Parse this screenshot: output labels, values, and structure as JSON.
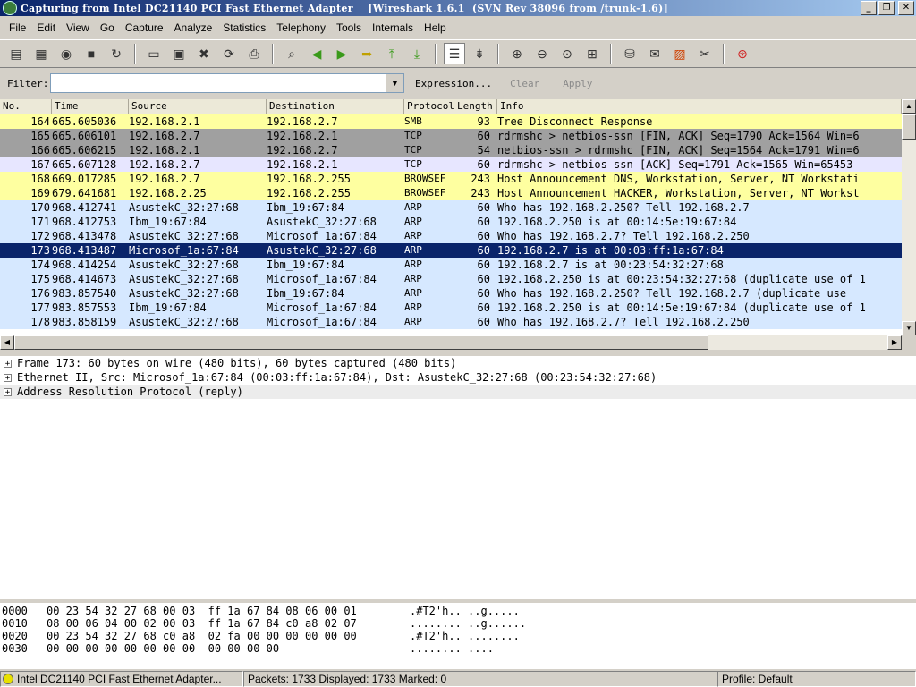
{
  "window": {
    "title": "Capturing from Intel DC21140 PCI Fast Ethernet Adapter    [Wireshark 1.6.1  (SVN Rev 38096 from /trunk-1.6)]",
    "minimize": "_",
    "maximize": "❐",
    "close": "✕"
  },
  "menu": [
    "File",
    "Edit",
    "View",
    "Go",
    "Capture",
    "Analyze",
    "Statistics",
    "Telephony",
    "Tools",
    "Internals",
    "Help"
  ],
  "filter": {
    "label": "Filter:",
    "value": "",
    "expression": "Expression...",
    "clear": "Clear",
    "apply": "Apply"
  },
  "columns": [
    "No.",
    "Time",
    "Source",
    "Destination",
    "Protocol",
    "Length",
    "Info"
  ],
  "colors": {
    "smb": "#feffa0",
    "tcp_dark": "#a0a0a0",
    "tcp_light": "#e7e6ff",
    "browser": "#feffa0",
    "arp": "#d6e8ff",
    "selected_bg": "#0a246a",
    "selected_fg": "#ffffff"
  },
  "packets": [
    {
      "no": "164",
      "time": "665.605036",
      "src": "192.168.2.1",
      "dst": "192.168.2.7",
      "proto": "SMB",
      "len": "93",
      "info": "Tree Disconnect Response",
      "color": "#feffa0"
    },
    {
      "no": "165",
      "time": "665.606101",
      "src": "192.168.2.7",
      "dst": "192.168.2.1",
      "proto": "TCP",
      "len": "60",
      "info": "rdrmshc > netbios-ssn [FIN, ACK] Seq=1790 Ack=1564 Win=6",
      "color": "#a0a0a0"
    },
    {
      "no": "166",
      "time": "665.606215",
      "src": "192.168.2.1",
      "dst": "192.168.2.7",
      "proto": "TCP",
      "len": "54",
      "info": "netbios-ssn > rdrmshc [FIN, ACK] Seq=1564 Ack=1791 Win=6",
      "color": "#a0a0a0"
    },
    {
      "no": "167",
      "time": "665.607128",
      "src": "192.168.2.7",
      "dst": "192.168.2.1",
      "proto": "TCP",
      "len": "60",
      "info": "rdrmshc > netbios-ssn [ACK] Seq=1791 Ack=1565 Win=65453",
      "color": "#e7e6ff"
    },
    {
      "no": "168",
      "time": "669.017285",
      "src": "192.168.2.7",
      "dst": "192.168.2.255",
      "proto": "BROWSEF",
      "len": "243",
      "info": "Host Announcement DNS, Workstation, Server, NT Workstati",
      "color": "#feffa0"
    },
    {
      "no": "169",
      "time": "679.641681",
      "src": "192.168.2.25",
      "dst": "192.168.2.255",
      "proto": "BROWSEF",
      "len": "243",
      "info": "Host Announcement HACKER, Workstation, Server, NT Workst",
      "color": "#feffa0"
    },
    {
      "no": "170",
      "time": "968.412741",
      "src": "AsustekC_32:27:68",
      "dst": "Ibm_19:67:84",
      "proto": "ARP",
      "len": "60",
      "info": "Who has 192.168.2.250?  Tell 192.168.2.7",
      "color": "#d6e8ff"
    },
    {
      "no": "171",
      "time": "968.412753",
      "src": "Ibm_19:67:84",
      "dst": "AsustekC_32:27:68",
      "proto": "ARP",
      "len": "60",
      "info": "192.168.2.250 is at 00:14:5e:19:67:84",
      "color": "#d6e8ff"
    },
    {
      "no": "172",
      "time": "968.413478",
      "src": "AsustekC_32:27:68",
      "dst": "Microsof_1a:67:84",
      "proto": "ARP",
      "len": "60",
      "info": "Who has 192.168.2.7?  Tell 192.168.2.250",
      "color": "#d6e8ff"
    },
    {
      "no": "173",
      "time": "968.413487",
      "src": "Microsof_1a:67:84",
      "dst": "AsustekC_32:27:68",
      "proto": "ARP",
      "len": "60",
      "info": "192.168.2.7 is at 00:03:ff:1a:67:84",
      "color": "#0a246a",
      "selected": true
    },
    {
      "no": "174",
      "time": "968.414254",
      "src": "AsustekC_32:27:68",
      "dst": "Ibm_19:67:84",
      "proto": "ARP",
      "len": "60",
      "info": "192.168.2.7 is at 00:23:54:32:27:68",
      "color": "#d6e8ff"
    },
    {
      "no": "175",
      "time": "968.414673",
      "src": "AsustekC_32:27:68",
      "dst": "Microsof_1a:67:84",
      "proto": "ARP",
      "len": "60",
      "info": "192.168.2.250 is at 00:23:54:32:27:68 (duplicate use of 1",
      "color": "#d6e8ff"
    },
    {
      "no": "176",
      "time": "983.857540",
      "src": "AsustekC_32:27:68",
      "dst": "Ibm_19:67:84",
      "proto": "ARP",
      "len": "60",
      "info": "Who has 192.168.2.250?  Tell 192.168.2.7 (duplicate use",
      "color": "#d6e8ff"
    },
    {
      "no": "177",
      "time": "983.857553",
      "src": "Ibm_19:67:84",
      "dst": "Microsof_1a:67:84",
      "proto": "ARP",
      "len": "60",
      "info": "192.168.2.250 is at 00:14:5e:19:67:84 (duplicate use of 1",
      "color": "#d6e8ff"
    },
    {
      "no": "178",
      "time": "983.858159",
      "src": "AsustekC_32:27:68",
      "dst": "Microsof_1a:67:84",
      "proto": "ARP",
      "len": "60",
      "info": "Who has 192.168.2.7?  Tell 192.168.2.250",
      "color": "#d6e8ff"
    }
  ],
  "details": [
    {
      "text": "Frame 173: 60 bytes on wire (480 bits), 60 bytes captured (480 bits)",
      "expander": "+"
    },
    {
      "text": "Ethernet II, Src: Microsof_1a:67:84 (00:03:ff:1a:67:84), Dst: AsustekC_32:27:68 (00:23:54:32:27:68)",
      "expander": "+"
    },
    {
      "text": "Address Resolution Protocol (reply)",
      "expander": "+"
    }
  ],
  "hex": [
    {
      "offset": "0000",
      "bytes": "00 23 54 32 27 68 00 03  ff 1a 67 84 08 06 00 01",
      "ascii": ".#T2'h.. ..g....."
    },
    {
      "offset": "0010",
      "bytes": "08 00 06 04 00 02 00 03  ff 1a 67 84 c0 a8 02 07",
      "ascii": "........ ..g......"
    },
    {
      "offset": "0020",
      "bytes": "00 23 54 32 27 68 c0 a8  02 fa 00 00 00 00 00 00",
      "ascii": ".#T2'h.. ........"
    },
    {
      "offset": "0030",
      "bytes": "00 00 00 00 00 00 00 00  00 00 00 00",
      "ascii": "........ ...."
    }
  ],
  "status": {
    "interface": "Intel DC21140 PCI Fast Ethernet Adapter...",
    "packets": "Packets: 1733 Displayed: 1733 Marked: 0",
    "profile": "Profile: Default"
  },
  "toolbar_icons": [
    "interface-list-icon",
    "capture-options-icon",
    "capture-start-icon",
    "capture-stop-icon",
    "capture-restart-icon",
    "open-icon",
    "save-icon",
    "close-icon",
    "reload-icon",
    "print-icon",
    "find-icon",
    "go-back-icon",
    "go-forward-icon",
    "go-to-packet-icon",
    "go-first-icon",
    "go-last-icon",
    "colorize-icon",
    "auto-scroll-icon",
    "zoom-in-icon",
    "zoom-out-icon",
    "zoom-normal-icon",
    "resize-columns-icon",
    "capture-filters-icon",
    "display-filters-icon",
    "coloring-rules-icon",
    "preferences-icon",
    "help-icon"
  ]
}
